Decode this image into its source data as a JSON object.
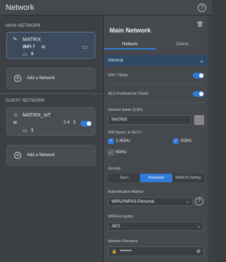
{
  "header": {
    "title": "Network",
    "help_icon": "?"
  },
  "left": {
    "main_network_label": "MAIN NETWORK",
    "main_card": {
      "name": "MATRIX",
      "wifi_label": "WiFi 7",
      "device_count": "6"
    },
    "add_network_label": "Add a Network",
    "guest_network_label": "GUEST NETWORK",
    "guest_card": {
      "name": "MATRIX_IoT",
      "band_a": "2.4",
      "band_b": "5",
      "device_count": "1"
    },
    "add_network_label_2": "Add a Network"
  },
  "right": {
    "title": "Main Network",
    "tabs": [
      {
        "label": "Network"
      },
      {
        "label": "Clients"
      }
    ],
    "general_label": "General",
    "wifi7_mode_label": "WiFi 7 Mode",
    "mlo_label": "MLO Frontload for Clients",
    "ssid_label": "Network Name (SSID)",
    "ssid_value": "MATRIX",
    "wifi_band_label": "WiFi Band ( ★ MLO )",
    "bands": [
      {
        "label": "2.4GHz"
      },
      {
        "label": "5GHz"
      },
      {
        "label": "6GHz"
      }
    ],
    "security_label": "Security",
    "security_options": [
      {
        "label": "Open"
      },
      {
        "label": "Password"
      },
      {
        "label": "RADIUS Setting"
      }
    ],
    "auth_label": "Authentication Method",
    "auth_value": "WPA2/WPA3-Personal",
    "encryption_label": "WPA Encryption",
    "encryption_value": "AES",
    "password_label": "Network Password",
    "password_value": "••••••••"
  },
  "colors": {
    "accent": "#2f7bd8",
    "bg": "#3c3f44",
    "panel": "#45484d",
    "selected_card": "#3b4a5c"
  }
}
